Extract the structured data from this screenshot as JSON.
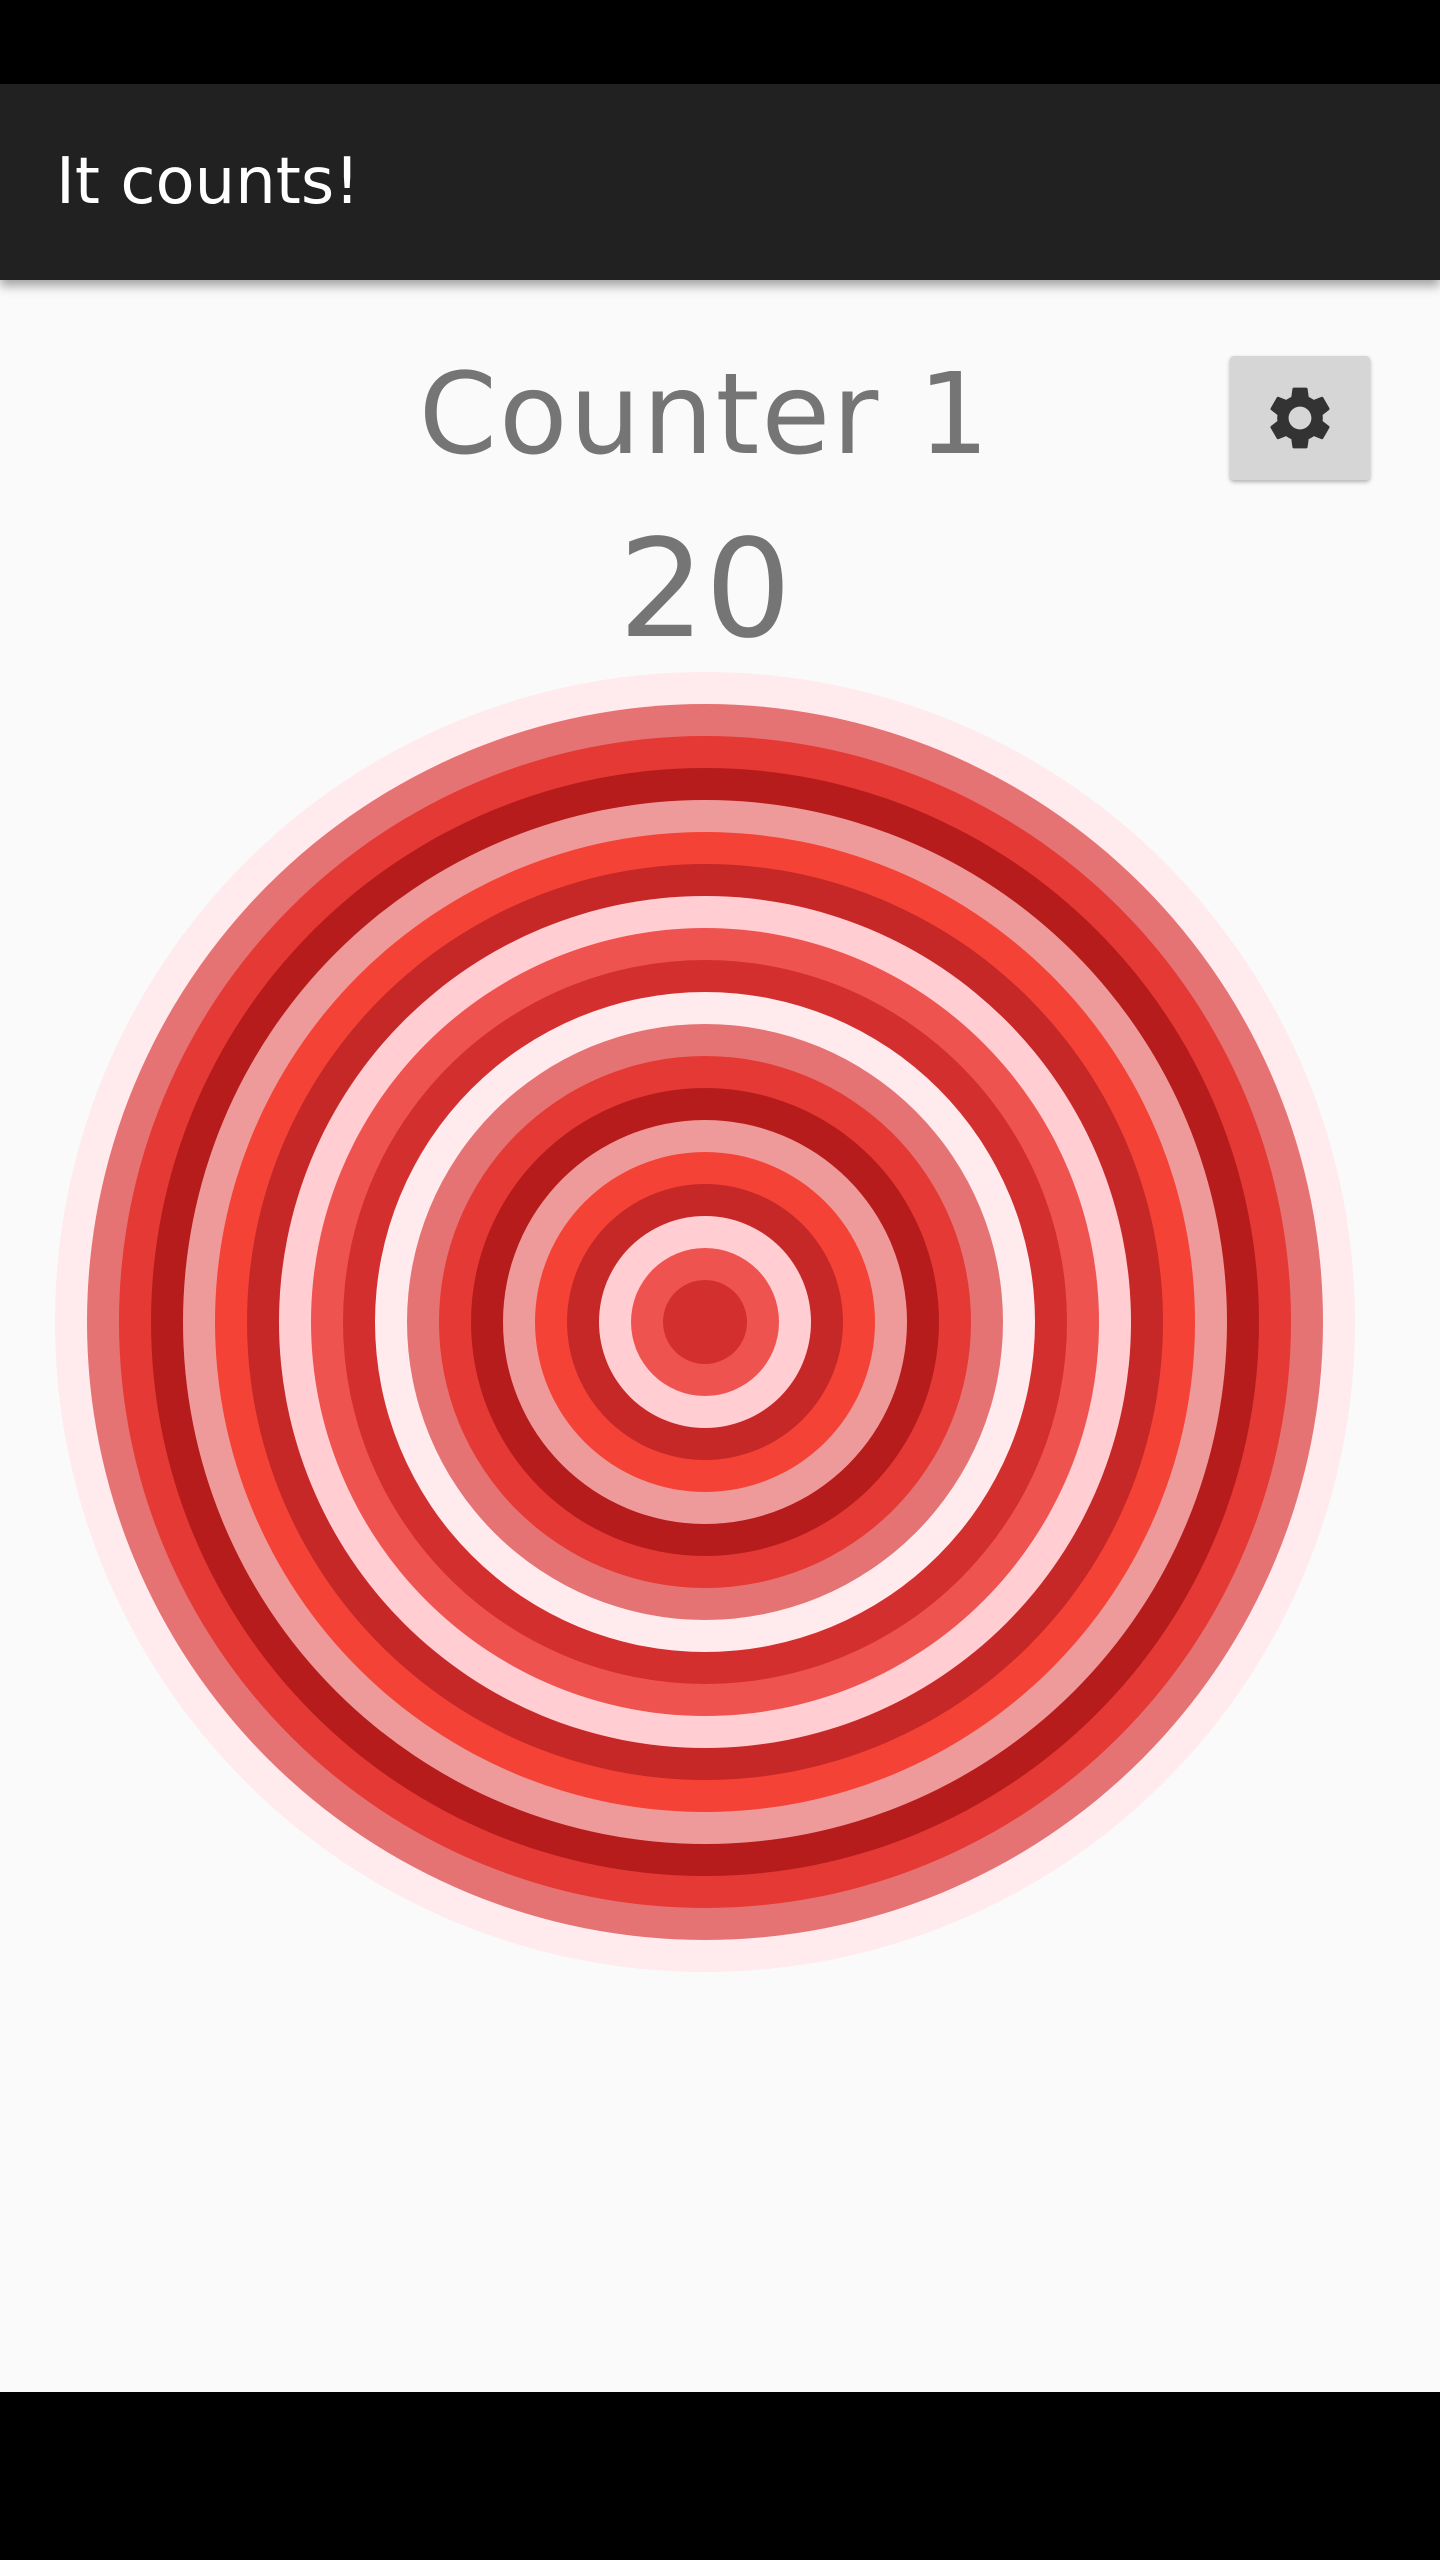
{
  "app_bar": {
    "title": "It counts!"
  },
  "counter": {
    "name": "Counter 1",
    "value": "20"
  },
  "settings": {
    "icon": "gear-icon"
  },
  "rings": {
    "count": 20,
    "colors": [
      "#ffebee",
      "#e57373",
      "#e53935",
      "#b71c1c",
      "#ef9a9a",
      "#f44336",
      "#c62828",
      "#ffcdd2",
      "#ef5350",
      "#d32f2f",
      "#ffebee",
      "#e57373",
      "#e53935",
      "#b71c1c",
      "#ef9a9a",
      "#f44336",
      "#c62828",
      "#ffcdd2",
      "#ef5350",
      "#d32f2f"
    ]
  },
  "colors": {
    "app_bar": "#212121",
    "background": "#fafafa",
    "text": "#757575"
  }
}
